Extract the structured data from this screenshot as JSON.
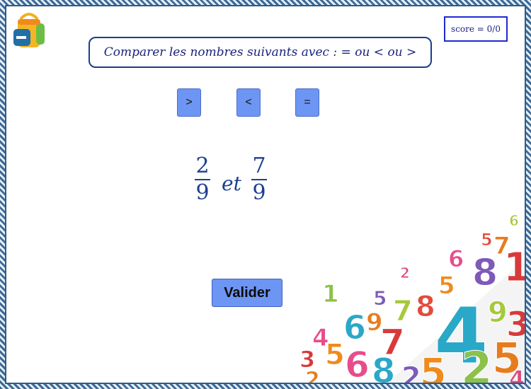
{
  "score": {
    "label": "score = 0/0"
  },
  "prompt": {
    "text": "Comparer les nombres suivants avec  :   = ou < ou >"
  },
  "operators": [
    {
      "label": ">"
    },
    {
      "label": "<"
    },
    {
      "label": "="
    }
  ],
  "comparison": {
    "first": {
      "numerator": "2",
      "denominator": "9"
    },
    "connector": "et",
    "second": {
      "numerator": "7",
      "denominator": "9"
    }
  },
  "validate": {
    "label": "Valider"
  },
  "decoration": {
    "digits_seen": [
      "6",
      "5",
      "2",
      "1",
      "6",
      "9",
      "7",
      "8",
      "4",
      "5",
      "6",
      "3",
      "2",
      "8",
      "5",
      "7"
    ],
    "colors": {
      "accent": "#6d95f3",
      "frame": "#3d6a96",
      "text": "#1a237e"
    }
  }
}
